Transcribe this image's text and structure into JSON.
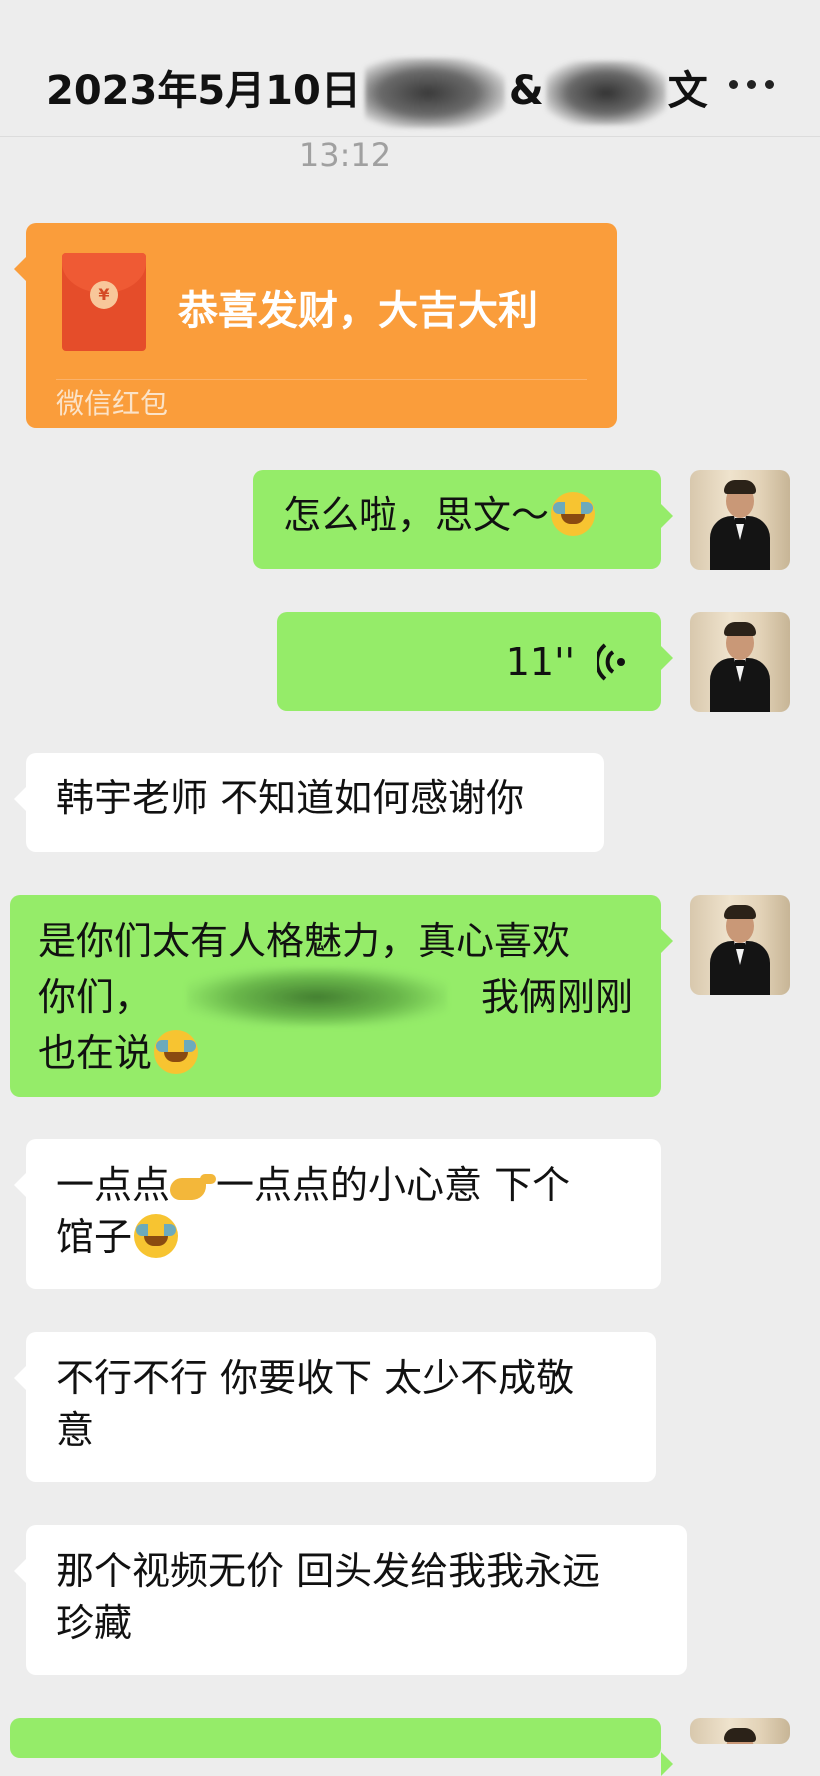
{
  "header": {
    "title_date": "2023年5月10日",
    "title_amp": "&",
    "title_end": "文",
    "more_icon": "more-dots-icon"
  },
  "timestamp": "13:12",
  "red_packet": {
    "greeting": "恭喜发财，大吉大利",
    "label": "微信红包",
    "coin_symbol": "¥",
    "color": "#fa9d3b"
  },
  "messages": [
    {
      "side": "right",
      "text": "怎么啦，思文～"
    },
    {
      "side": "right",
      "type": "voice",
      "duration": "11''"
    },
    {
      "side": "left",
      "text": "韩宇老师 不知道如何感谢你"
    },
    {
      "side": "right",
      "line1": "是你们太有人格魅力，真心喜欢",
      "line2_a": "你们，",
      "line2_b": "我俩刚刚",
      "line3": "也在说"
    },
    {
      "side": "left",
      "a": "一点点",
      "b": "一点点的小心意 下个",
      "c": "馆子"
    },
    {
      "side": "left",
      "line1": "不行不行 你要收下 太少不成敬",
      "line2": "意"
    },
    {
      "side": "left",
      "line1": "那个视频无价 回头发给我我永远",
      "line2": "珍藏"
    }
  ],
  "colors": {
    "bg": "#ededed",
    "green_bubble": "#95ec69",
    "white_bubble": "#ffffff"
  }
}
